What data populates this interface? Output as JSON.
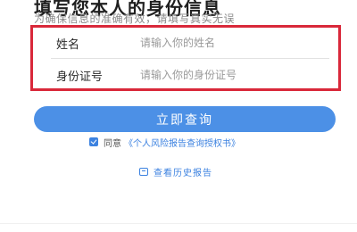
{
  "header": {
    "title": "填写您本人的身份信息",
    "subtitle": "为确保信息的准确有效，请填写真实无误"
  },
  "form": {
    "name_label": "姓名",
    "name_placeholder": "请输入你的姓名",
    "name_value": "",
    "id_label": "身份证号",
    "id_placeholder": "请输入你的身份证号",
    "id_value": ""
  },
  "actions": {
    "submit_label": "立即查询"
  },
  "agreement": {
    "checked": true,
    "prefix": "同意",
    "link_text": "《个人风险报告查询授权书》"
  },
  "history": {
    "icon": "document-icon",
    "label": "查看历史报告"
  },
  "colors": {
    "accent": "#4c90e6",
    "link": "#3c82e0",
    "highlight_border": "#d9283a"
  }
}
